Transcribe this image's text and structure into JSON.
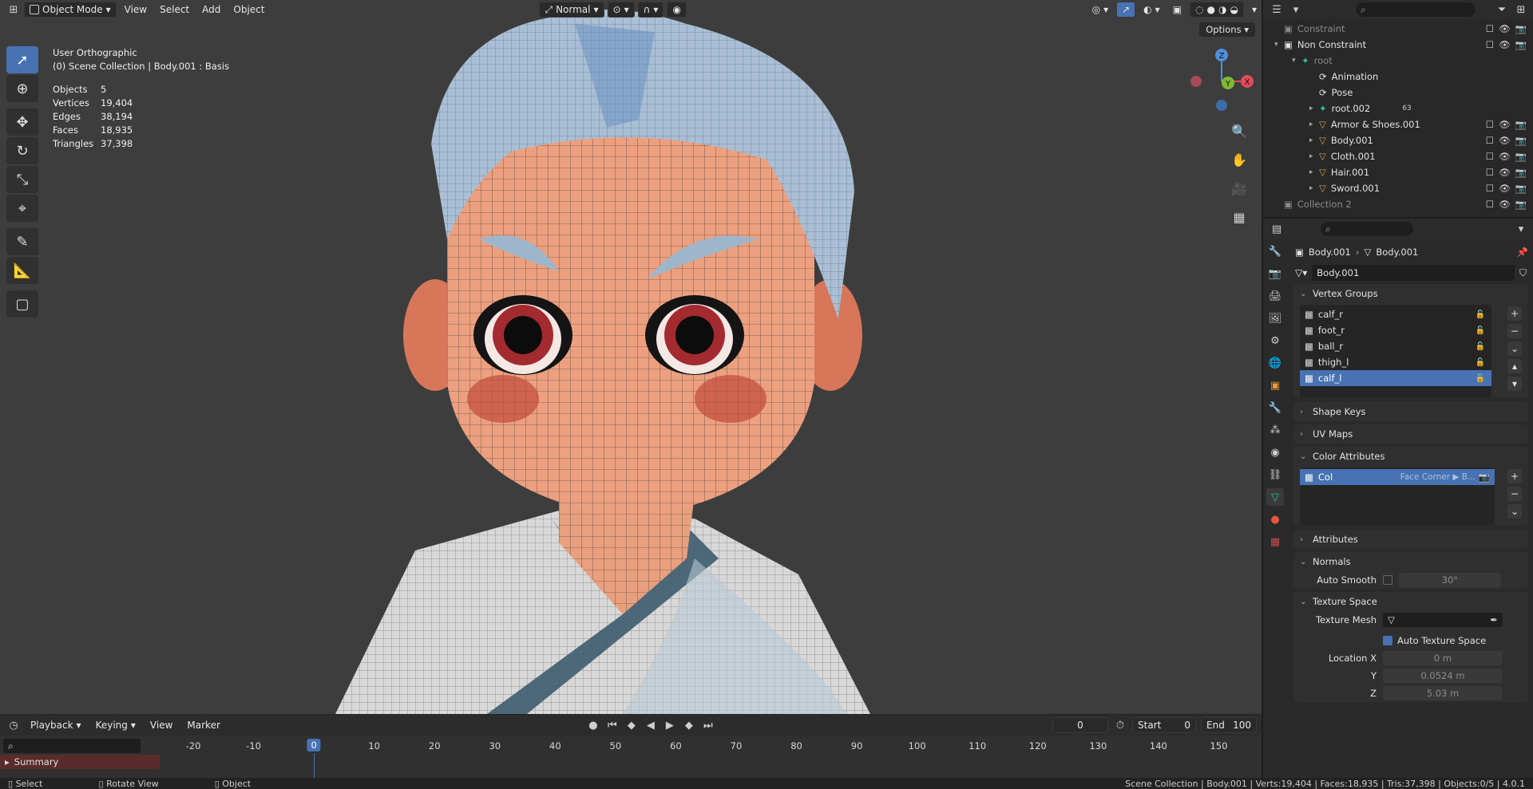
{
  "header": {
    "mode": "Object Mode",
    "menus": [
      "View",
      "Select",
      "Add",
      "Object"
    ],
    "transform_orientation": "Normal",
    "options": "Options"
  },
  "overlay": {
    "view_name": "User Orthographic",
    "collection_info": "(0) Scene Collection | Body.001 : Basis"
  },
  "stats": [
    {
      "label": "Objects",
      "value": "5"
    },
    {
      "label": "Vertices",
      "value": "19,404"
    },
    {
      "label": "Edges",
      "value": "38,194"
    },
    {
      "label": "Faces",
      "value": "18,935"
    },
    {
      "label": "Triangles",
      "value": "37,398"
    }
  ],
  "gizmo": {
    "x": "X",
    "y": "Y",
    "z": "Z"
  },
  "outliner": {
    "rows": [
      {
        "label": "Constraint",
        "indent": 0,
        "dim": true
      },
      {
        "label": "Non Constraint",
        "indent": 0
      },
      {
        "label": "root",
        "indent": 1,
        "dim": true
      },
      {
        "label": "Animation",
        "indent": 2
      },
      {
        "label": "Pose",
        "indent": 2
      },
      {
        "label": "root.002",
        "indent": 2,
        "badge": "63"
      },
      {
        "label": "Armor & Shoes.001",
        "indent": 2
      },
      {
        "label": "Body.001",
        "indent": 2
      },
      {
        "label": "Cloth.001",
        "indent": 2
      },
      {
        "label": "Hair.001",
        "indent": 2
      },
      {
        "label": "Sword.001",
        "indent": 2
      },
      {
        "label": "Collection 2",
        "indent": 0,
        "dim": true
      }
    ]
  },
  "properties": {
    "breadcrumb_object": "Body.001",
    "breadcrumb_data": "Body.001",
    "datablock_name": "Body.001",
    "vertex_groups_title": "Vertex Groups",
    "vertex_groups": [
      "calf_r",
      "foot_r",
      "ball_r",
      "thigh_l",
      "calf_l"
    ],
    "shape_keys": "Shape Keys",
    "uv_maps": "UV Maps",
    "color_attributes_title": "Color Attributes",
    "color_attribute": {
      "name": "Col",
      "domain": "Face Corner ▶ B..."
    },
    "attributes": "Attributes",
    "normals": "Normals",
    "auto_smooth_label": "Auto Smooth",
    "auto_smooth_value": "30°",
    "texture_space": "Texture Space",
    "texture_mesh_label": "Texture Mesh",
    "auto_texture_space": "Auto Texture Space",
    "location_label": "Location X",
    "loc_y_label": "Y",
    "loc_z_label": "Z",
    "loc_x": "0 m",
    "loc_y": "0.0524 m",
    "loc_z": "5.03 m"
  },
  "timeline": {
    "menus": [
      "Playback",
      "Keying",
      "View",
      "Marker"
    ],
    "current_frame": "0",
    "start_label": "Start",
    "start": "0",
    "end_label": "End",
    "end": "100",
    "ticks": [
      "-20",
      "-10",
      "0",
      "10",
      "20",
      "30",
      "40",
      "50",
      "60",
      "70",
      "80",
      "90",
      "100",
      "110",
      "120",
      "130",
      "140",
      "150"
    ],
    "summary": "Summary"
  },
  "statusbar": {
    "select": "Select",
    "rotate": "Rotate View",
    "object": "Object",
    "info": "Scene Collection | Body.001 | Verts:19,404 | Faces:18,935 | Tris:37,398 | Objects:0/5 | 4.0.1"
  }
}
